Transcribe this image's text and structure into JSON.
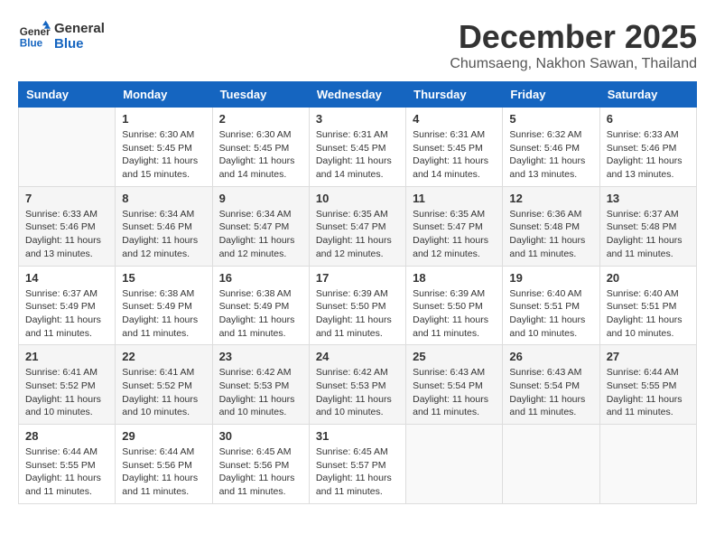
{
  "header": {
    "logo_line1": "General",
    "logo_line2": "Blue",
    "month": "December 2025",
    "location": "Chumsaeng, Nakhon Sawan, Thailand"
  },
  "weekdays": [
    "Sunday",
    "Monday",
    "Tuesday",
    "Wednesday",
    "Thursday",
    "Friday",
    "Saturday"
  ],
  "weeks": [
    [
      {
        "day": "",
        "sunrise": "",
        "sunset": "",
        "daylight": ""
      },
      {
        "day": "1",
        "sunrise": "Sunrise: 6:30 AM",
        "sunset": "Sunset: 5:45 PM",
        "daylight": "Daylight: 11 hours and 15 minutes."
      },
      {
        "day": "2",
        "sunrise": "Sunrise: 6:30 AM",
        "sunset": "Sunset: 5:45 PM",
        "daylight": "Daylight: 11 hours and 14 minutes."
      },
      {
        "day": "3",
        "sunrise": "Sunrise: 6:31 AM",
        "sunset": "Sunset: 5:45 PM",
        "daylight": "Daylight: 11 hours and 14 minutes."
      },
      {
        "day": "4",
        "sunrise": "Sunrise: 6:31 AM",
        "sunset": "Sunset: 5:45 PM",
        "daylight": "Daylight: 11 hours and 14 minutes."
      },
      {
        "day": "5",
        "sunrise": "Sunrise: 6:32 AM",
        "sunset": "Sunset: 5:46 PM",
        "daylight": "Daylight: 11 hours and 13 minutes."
      },
      {
        "day": "6",
        "sunrise": "Sunrise: 6:33 AM",
        "sunset": "Sunset: 5:46 PM",
        "daylight": "Daylight: 11 hours and 13 minutes."
      }
    ],
    [
      {
        "day": "7",
        "sunrise": "Sunrise: 6:33 AM",
        "sunset": "Sunset: 5:46 PM",
        "daylight": "Daylight: 11 hours and 13 minutes."
      },
      {
        "day": "8",
        "sunrise": "Sunrise: 6:34 AM",
        "sunset": "Sunset: 5:46 PM",
        "daylight": "Daylight: 11 hours and 12 minutes."
      },
      {
        "day": "9",
        "sunrise": "Sunrise: 6:34 AM",
        "sunset": "Sunset: 5:47 PM",
        "daylight": "Daylight: 11 hours and 12 minutes."
      },
      {
        "day": "10",
        "sunrise": "Sunrise: 6:35 AM",
        "sunset": "Sunset: 5:47 PM",
        "daylight": "Daylight: 11 hours and 12 minutes."
      },
      {
        "day": "11",
        "sunrise": "Sunrise: 6:35 AM",
        "sunset": "Sunset: 5:47 PM",
        "daylight": "Daylight: 11 hours and 12 minutes."
      },
      {
        "day": "12",
        "sunrise": "Sunrise: 6:36 AM",
        "sunset": "Sunset: 5:48 PM",
        "daylight": "Daylight: 11 hours and 11 minutes."
      },
      {
        "day": "13",
        "sunrise": "Sunrise: 6:37 AM",
        "sunset": "Sunset: 5:48 PM",
        "daylight": "Daylight: 11 hours and 11 minutes."
      }
    ],
    [
      {
        "day": "14",
        "sunrise": "Sunrise: 6:37 AM",
        "sunset": "Sunset: 5:49 PM",
        "daylight": "Daylight: 11 hours and 11 minutes."
      },
      {
        "day": "15",
        "sunrise": "Sunrise: 6:38 AM",
        "sunset": "Sunset: 5:49 PM",
        "daylight": "Daylight: 11 hours and 11 minutes."
      },
      {
        "day": "16",
        "sunrise": "Sunrise: 6:38 AM",
        "sunset": "Sunset: 5:49 PM",
        "daylight": "Daylight: 11 hours and 11 minutes."
      },
      {
        "day": "17",
        "sunrise": "Sunrise: 6:39 AM",
        "sunset": "Sunset: 5:50 PM",
        "daylight": "Daylight: 11 hours and 11 minutes."
      },
      {
        "day": "18",
        "sunrise": "Sunrise: 6:39 AM",
        "sunset": "Sunset: 5:50 PM",
        "daylight": "Daylight: 11 hours and 11 minutes."
      },
      {
        "day": "19",
        "sunrise": "Sunrise: 6:40 AM",
        "sunset": "Sunset: 5:51 PM",
        "daylight": "Daylight: 11 hours and 10 minutes."
      },
      {
        "day": "20",
        "sunrise": "Sunrise: 6:40 AM",
        "sunset": "Sunset: 5:51 PM",
        "daylight": "Daylight: 11 hours and 10 minutes."
      }
    ],
    [
      {
        "day": "21",
        "sunrise": "Sunrise: 6:41 AM",
        "sunset": "Sunset: 5:52 PM",
        "daylight": "Daylight: 11 hours and 10 minutes."
      },
      {
        "day": "22",
        "sunrise": "Sunrise: 6:41 AM",
        "sunset": "Sunset: 5:52 PM",
        "daylight": "Daylight: 11 hours and 10 minutes."
      },
      {
        "day": "23",
        "sunrise": "Sunrise: 6:42 AM",
        "sunset": "Sunset: 5:53 PM",
        "daylight": "Daylight: 11 hours and 10 minutes."
      },
      {
        "day": "24",
        "sunrise": "Sunrise: 6:42 AM",
        "sunset": "Sunset: 5:53 PM",
        "daylight": "Daylight: 11 hours and 10 minutes."
      },
      {
        "day": "25",
        "sunrise": "Sunrise: 6:43 AM",
        "sunset": "Sunset: 5:54 PM",
        "daylight": "Daylight: 11 hours and 11 minutes."
      },
      {
        "day": "26",
        "sunrise": "Sunrise: 6:43 AM",
        "sunset": "Sunset: 5:54 PM",
        "daylight": "Daylight: 11 hours and 11 minutes."
      },
      {
        "day": "27",
        "sunrise": "Sunrise: 6:44 AM",
        "sunset": "Sunset: 5:55 PM",
        "daylight": "Daylight: 11 hours and 11 minutes."
      }
    ],
    [
      {
        "day": "28",
        "sunrise": "Sunrise: 6:44 AM",
        "sunset": "Sunset: 5:55 PM",
        "daylight": "Daylight: 11 hours and 11 minutes."
      },
      {
        "day": "29",
        "sunrise": "Sunrise: 6:44 AM",
        "sunset": "Sunset: 5:56 PM",
        "daylight": "Daylight: 11 hours and 11 minutes."
      },
      {
        "day": "30",
        "sunrise": "Sunrise: 6:45 AM",
        "sunset": "Sunset: 5:56 PM",
        "daylight": "Daylight: 11 hours and 11 minutes."
      },
      {
        "day": "31",
        "sunrise": "Sunrise: 6:45 AM",
        "sunset": "Sunset: 5:57 PM",
        "daylight": "Daylight: 11 hours and 11 minutes."
      },
      {
        "day": "",
        "sunrise": "",
        "sunset": "",
        "daylight": ""
      },
      {
        "day": "",
        "sunrise": "",
        "sunset": "",
        "daylight": ""
      },
      {
        "day": "",
        "sunrise": "",
        "sunset": "",
        "daylight": ""
      }
    ]
  ]
}
